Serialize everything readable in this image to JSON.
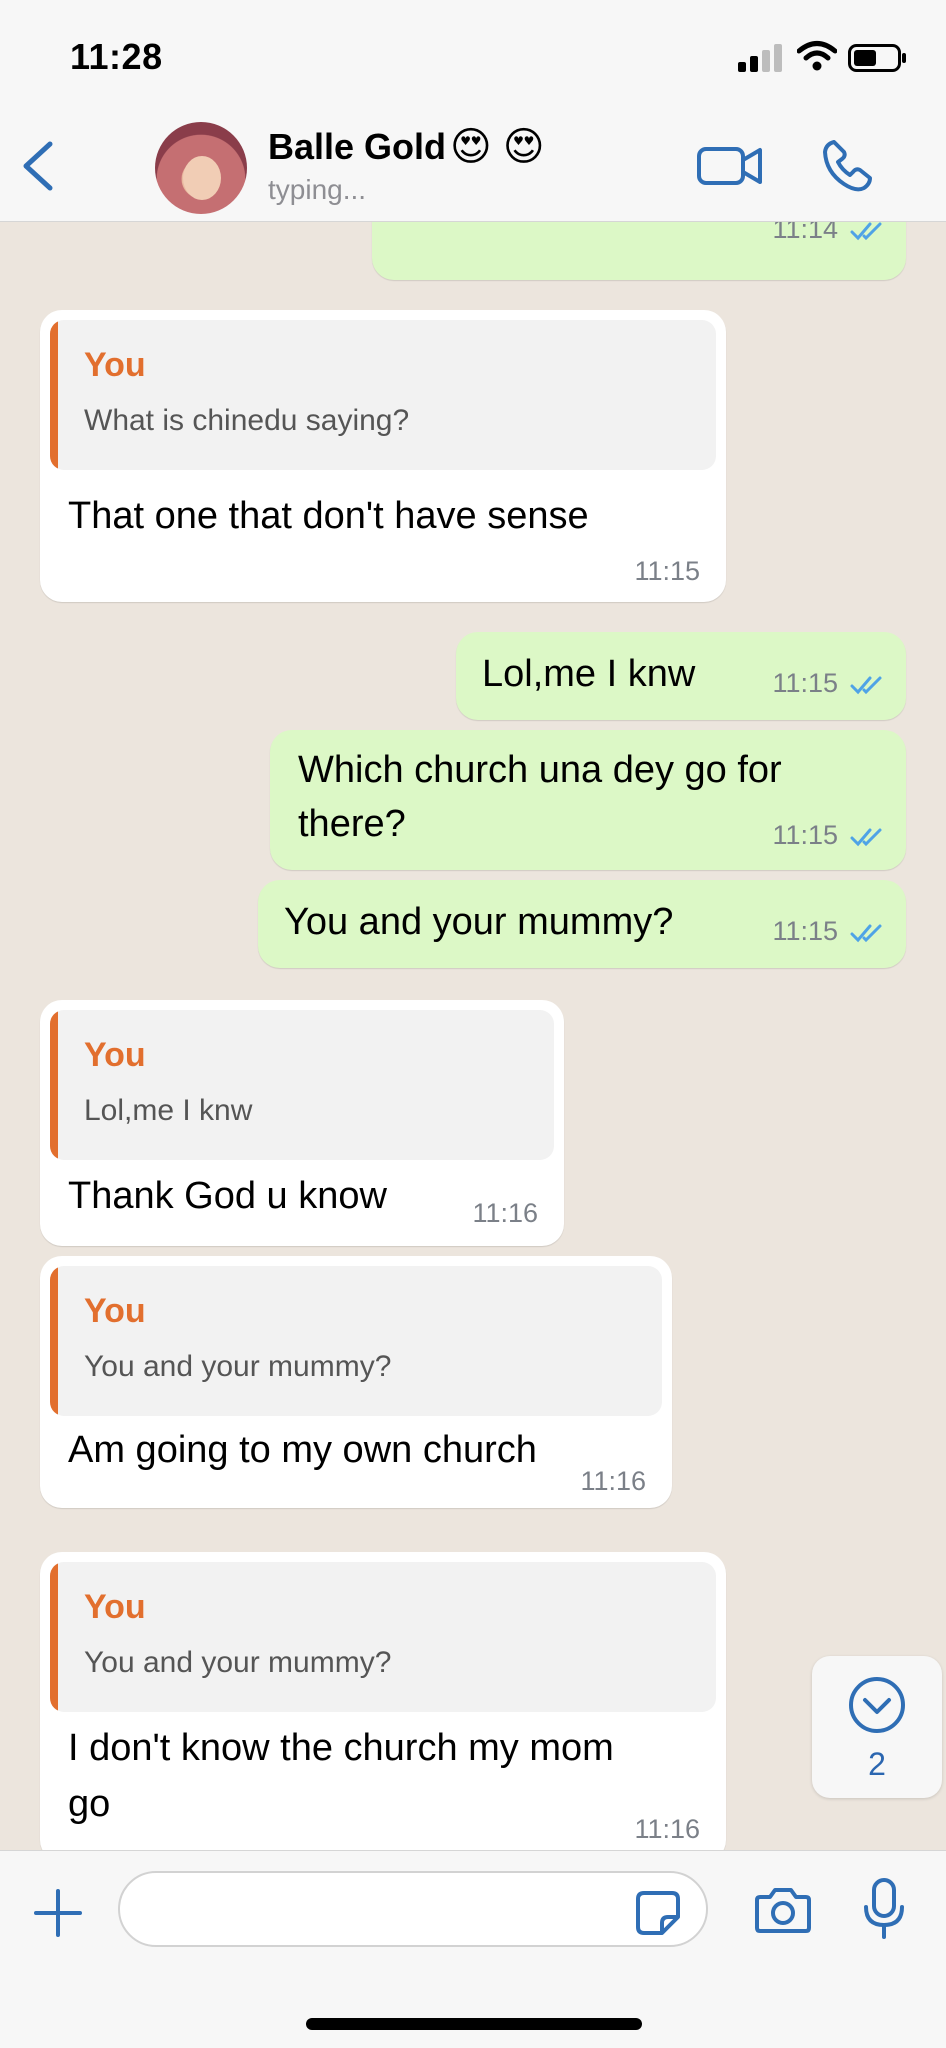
{
  "status_bar": {
    "time": "11:28"
  },
  "header": {
    "contact_name": "Balle Gold",
    "contact_emojis": "😍 😍",
    "contact_status": "typing...",
    "accent_color": "#2f6eb5"
  },
  "messages": [
    {
      "direction": "out",
      "text": "",
      "time": "11:14",
      "read": true
    },
    {
      "direction": "in",
      "quote_author": "You",
      "quote_text": "What is chinedu saying?",
      "text": "That one that don't have sense",
      "time": "11:15"
    },
    {
      "direction": "out",
      "text": "Lol,me I knw",
      "time": "11:15",
      "read": true
    },
    {
      "direction": "out",
      "text_line1": "Which church una dey go for",
      "text_line2": "there?",
      "time": "11:15",
      "read": true
    },
    {
      "direction": "out",
      "text": "You and your mummy?",
      "time": "11:15",
      "read": true
    },
    {
      "direction": "in",
      "quote_author": "You",
      "quote_text": "Lol,me I knw",
      "text": "Thank God u know",
      "time": "11:16"
    },
    {
      "direction": "in",
      "quote_author": "You",
      "quote_text": "You and your mummy?",
      "text": "Am going to my own church",
      "time": "11:16"
    },
    {
      "direction": "in",
      "quote_author": "You",
      "quote_text": "You and your mummy?",
      "text_line1": "I don't know the church my mom",
      "text_line2": "go",
      "time": "11:16"
    }
  ],
  "scroll_badge": {
    "unread": "2"
  },
  "input": {
    "placeholder": ""
  },
  "colors": {
    "outgoing_bubble": "#dcf8c6",
    "incoming_bubble": "#ffffff",
    "quote_accent": "#e26f2e",
    "read_ticks": "#4fa3e6"
  },
  "icons": [
    "back-chevron-icon",
    "video-call-icon",
    "phone-icon",
    "chevron-down-icon",
    "plus-icon",
    "sticker-icon",
    "camera-icon",
    "mic-icon"
  ]
}
